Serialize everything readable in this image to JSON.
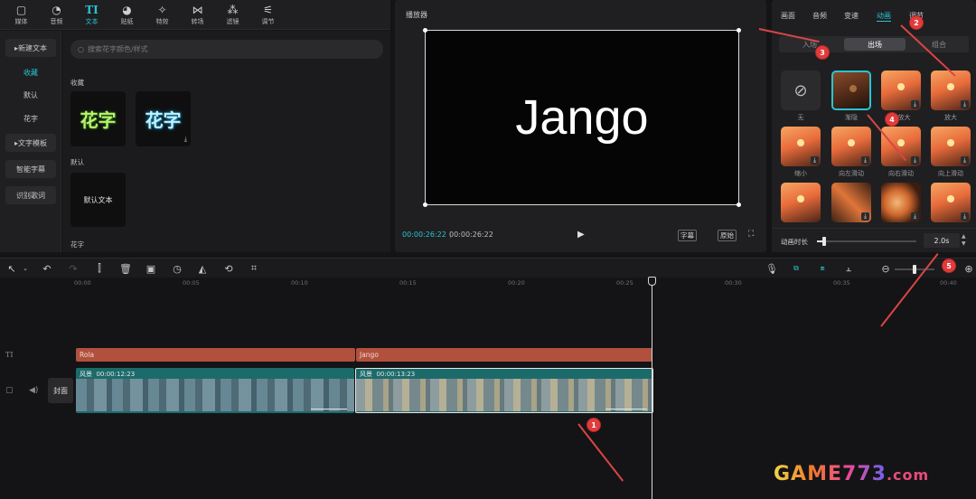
{
  "toolbar": {
    "tabs": [
      {
        "label": "媒体",
        "icon": "media-icon"
      },
      {
        "label": "音频",
        "icon": "audio-icon"
      },
      {
        "label": "文本",
        "icon": "text-icon"
      },
      {
        "label": "贴纸",
        "icon": "sticker-icon"
      },
      {
        "label": "特效",
        "icon": "effects-icon"
      },
      {
        "label": "转场",
        "icon": "transition-icon"
      },
      {
        "label": "滤镜",
        "icon": "filter-icon"
      },
      {
        "label": "调节",
        "icon": "adjust-icon"
      }
    ],
    "active_index": 2,
    "text_tab_glyph": "TI"
  },
  "sidebar": {
    "items": [
      "新建文本",
      "收藏",
      "默认",
      "花字",
      "文字模板",
      "智能字幕",
      "识别歌词"
    ]
  },
  "library": {
    "search_placeholder": "搜索花字颜色/样式",
    "sections": {
      "favorites": "收藏",
      "default": "默认",
      "fancy": "花字"
    },
    "tiles": {
      "fancy1": "花字",
      "fancy2": "花字",
      "default_text": "默认文本"
    }
  },
  "player": {
    "title": "播放器",
    "canvas_text": "Jango",
    "time_current": "00:00:26:22",
    "time_total": "00:00:26:22",
    "btn_guide": "字幕",
    "btn_original": "原始"
  },
  "props": {
    "tabs": [
      "画面",
      "音频",
      "变速",
      "动画",
      "调节"
    ],
    "active_tab": 3,
    "subtabs": [
      "入场",
      "出场",
      "组合"
    ],
    "active_subtab": 1,
    "animations": [
      [
        "无",
        "渐隐",
        "渐放大",
        "放大"
      ],
      [
        "缩小",
        "向左滑动",
        "向右滑动",
        "向上滑动"
      ],
      [
        "",
        "",
        "",
        ""
      ]
    ],
    "duration_label": "动画时长",
    "duration_value": "2.0s",
    "duration_fraction": 0.07
  },
  "timeline": {
    "ticks": [
      "00:00",
      "00:05",
      "00:10",
      "00:15",
      "00:20",
      "00:25",
      "00:30",
      "00:35",
      "00:40"
    ],
    "text_clips": [
      "Rola",
      "Jango"
    ],
    "video_clips": [
      {
        "name": "风景",
        "duration": "00:00:12:23"
      },
      {
        "name": "风景",
        "duration": "00:00:13:23"
      }
    ],
    "cover_label": "封面",
    "text_track_glyph": "TI",
    "zoom_fraction": 0.5
  },
  "annotations": [
    "1",
    "2",
    "3",
    "4",
    "5"
  ],
  "watermark": {
    "text": "GAME773",
    "suffix": ".com"
  },
  "colors": {
    "accent": "#29c4d2",
    "text_clip": "#b2503e",
    "video_clip": "#1b6b6b",
    "annotation": "#e23b3b"
  }
}
